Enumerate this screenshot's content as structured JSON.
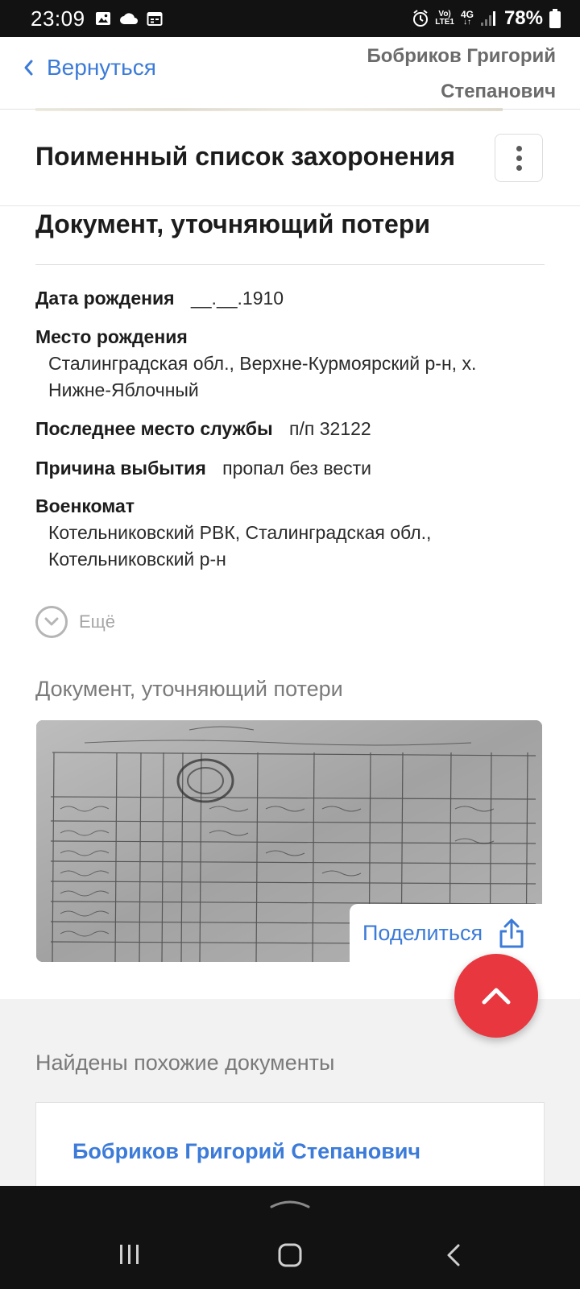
{
  "status_bar": {
    "time": "23:09",
    "network_top": "Vo)",
    "network_bottom": "LTE1",
    "signal_type": "4G",
    "battery": "78%",
    "icons": [
      "image-icon",
      "cloud-icon",
      "calendar-icon",
      "alarm-icon",
      "signal-icon",
      "battery-icon"
    ]
  },
  "header": {
    "back_label": "Вернуться",
    "person_name": "Бобриков Григорий Степанович"
  },
  "sticky": {
    "title": "Поименный список захоронения"
  },
  "record": {
    "section_title": "Документ, уточняющий потери",
    "birth_date_label": "Дата рождения",
    "birth_date_value": "__.__.1910",
    "birth_place_label": "Место рождения",
    "birth_place_value": "Сталинградская обл., Верхне-Курмоярский р-н, х. Нижне-Яблочный",
    "service_label": "Последнее место службы",
    "service_value": "п/п 32122",
    "reason_label": "Причина выбытия",
    "reason_value": "пропал без вести",
    "enlistment_label": "Военкомат",
    "enlistment_value": "Котельниковский РВК, Сталинградская обл., Котельниковский р-н",
    "more_label": "Ещё"
  },
  "document": {
    "caption": "Документ, уточняющий потери",
    "share_label": "Поделиться"
  },
  "similar": {
    "title": "Найдены похожие документы",
    "first_name": "Бобриков Григорий Степанович"
  },
  "colors": {
    "accent": "#3c7bd8",
    "fab": "#e8373f",
    "muted": "#7a7a7a"
  }
}
